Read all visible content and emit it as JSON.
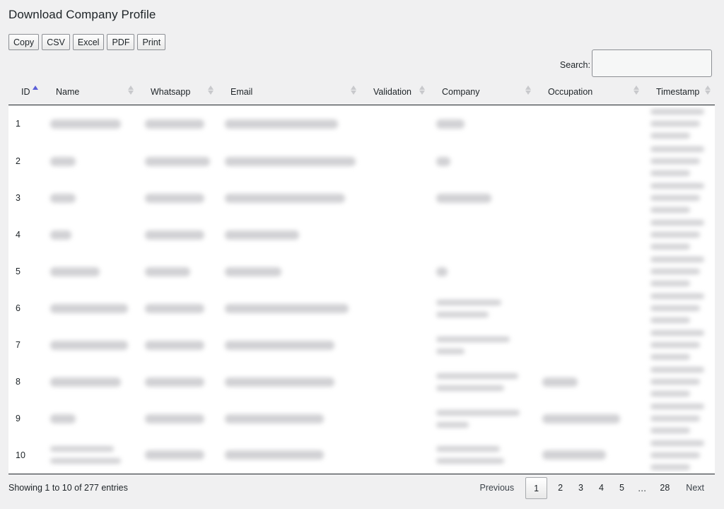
{
  "title": "Download Company Profile",
  "toolbar": {
    "buttons": [
      {
        "label": "Copy",
        "name": "copy-button"
      },
      {
        "label": "CSV",
        "name": "csv-button"
      },
      {
        "label": "Excel",
        "name": "excel-button"
      },
      {
        "label": "PDF",
        "name": "pdf-button"
      },
      {
        "label": "Print",
        "name": "print-button"
      }
    ]
  },
  "search": {
    "label": "Search:",
    "value": "",
    "placeholder": ""
  },
  "table": {
    "columns": [
      {
        "label": "ID",
        "name": "col-id",
        "sort": "asc"
      },
      {
        "label": "Name",
        "name": "col-name",
        "sort": "none"
      },
      {
        "label": "Whatsapp",
        "name": "col-whatsapp",
        "sort": "none"
      },
      {
        "label": "Email",
        "name": "col-email",
        "sort": "none"
      },
      {
        "label": "Validation",
        "name": "col-validation",
        "sort": "none"
      },
      {
        "label": "Company",
        "name": "col-company",
        "sort": "none"
      },
      {
        "label": "Occupation",
        "name": "col-occupation",
        "sort": "none"
      },
      {
        "label": "Timestamp",
        "name": "col-timestamp",
        "sort": "none"
      }
    ],
    "rows": [
      {
        "id": "1"
      },
      {
        "id": "2"
      },
      {
        "id": "3"
      },
      {
        "id": "4"
      },
      {
        "id": "5"
      },
      {
        "id": "6"
      },
      {
        "id": "7"
      },
      {
        "id": "8"
      },
      {
        "id": "9"
      },
      {
        "id": "10"
      }
    ]
  },
  "footer": {
    "info": "Showing 1 to 10 of 277 entries"
  },
  "pagination": {
    "previous": "Previous",
    "next": "Next",
    "pages": [
      "1",
      "2",
      "3",
      "4",
      "5"
    ],
    "ellipsis": "…",
    "last": "28",
    "current": "1"
  }
}
